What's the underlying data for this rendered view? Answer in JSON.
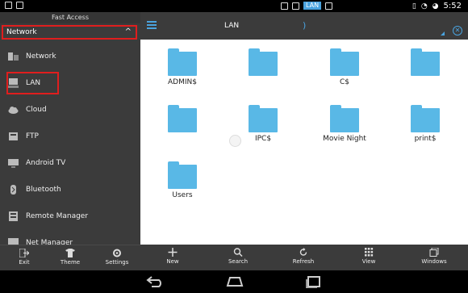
{
  "status_bar": {
    "time": "5:52",
    "lan_chip": "LAN"
  },
  "sidebar": {
    "title": "Fast Access",
    "section": "Network",
    "items": [
      {
        "label": "Network",
        "icon": "network-icon"
      },
      {
        "label": "LAN",
        "icon": "lan-icon"
      },
      {
        "label": "Cloud",
        "icon": "cloud-icon"
      },
      {
        "label": "FTP",
        "icon": "ftp-icon"
      },
      {
        "label": "Android TV",
        "icon": "tv-icon"
      },
      {
        "label": "Bluetooth",
        "icon": "bluetooth-icon"
      },
      {
        "label": "Remote Manager",
        "icon": "remote-manager-icon"
      },
      {
        "label": "Net Manager",
        "icon": "net-manager-icon"
      }
    ],
    "toolbar": [
      {
        "label": "Exit",
        "icon": "exit-icon"
      },
      {
        "label": "Theme",
        "icon": "theme-icon"
      },
      {
        "label": "Settings",
        "icon": "gear-icon"
      }
    ]
  },
  "topbar": {
    "path": "LAN"
  },
  "folders": [
    {
      "name": "ADMIN$"
    },
    {
      "name": ""
    },
    {
      "name": "C$"
    },
    {
      "name": ""
    },
    {
      "name": ""
    },
    {
      "name": "IPC$"
    },
    {
      "name": "Movie Night"
    },
    {
      "name": "print$"
    },
    {
      "name": "Users"
    }
  ],
  "main_toolbar": [
    {
      "label": "New",
      "icon": "plus-icon"
    },
    {
      "label": "Search",
      "icon": "search-icon"
    },
    {
      "label": "Refresh",
      "icon": "refresh-icon"
    },
    {
      "label": "View",
      "icon": "grid-icon"
    },
    {
      "label": "Windows",
      "icon": "windows-icon"
    }
  ],
  "colors": {
    "accent": "#4aa3df",
    "folder": "#59b8e6",
    "highlight": "#e01e1e",
    "panel": "#3b3b3b"
  }
}
